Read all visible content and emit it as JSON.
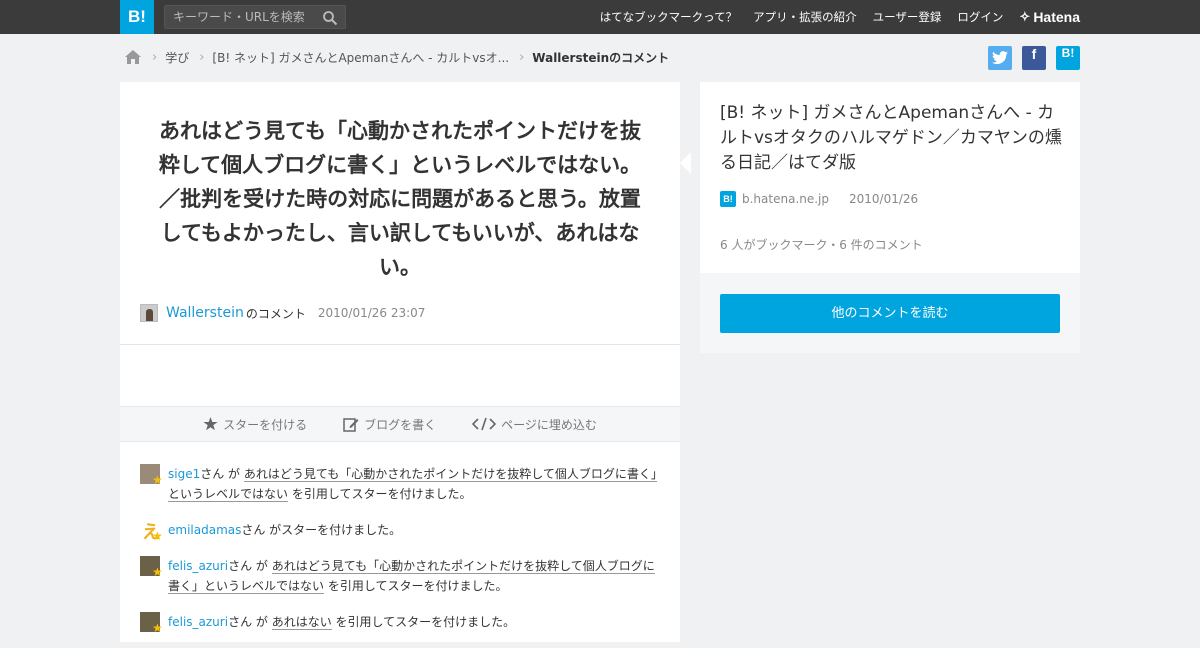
{
  "header": {
    "logo": "B!",
    "search_placeholder": "キーワード・URLを検索",
    "nav": [
      "はてなブックマークって？",
      "アプリ・拡張の紹介",
      "ユーザー登録",
      "ログイン"
    ],
    "brand": "Hatena"
  },
  "breadcrumb": {
    "items": [
      "学び",
      "[B! ネット] ガメさんとApemanさんへ - カルトvsオ...",
      "Wallersteinのコメント"
    ]
  },
  "share": {
    "twitter": "t",
    "facebook": "f",
    "hatena": "B!"
  },
  "comment": {
    "text": "あれはどう見ても「心動かされたポイントだけを抜粋して個人ブログに書く」というレベルではない。／批判を受けた時の対応に問題があると思う。放置してもよかったし、言い訳してもいいが、あれはない。",
    "author": "Wallerstein",
    "author_suffix": "のコメント",
    "date": "2010/01/26 23:07"
  },
  "actions": {
    "star": "スターを付ける",
    "blog": "ブログを書く",
    "embed": "ページに埋め込む"
  },
  "stars": [
    {
      "user": "sige1",
      "mid": "さん が ",
      "quote": "あれはどう見ても「心動かされたポイントだけを抜粋して個人ブログに書く」というレベルではない",
      "tail": " を引用してスターを付けました。"
    },
    {
      "user": "emiladamas",
      "mid": "さん がスターを付けました。",
      "quote": "",
      "tail": ""
    },
    {
      "user": "felis_azuri",
      "mid": "さん が ",
      "quote": "あれはどう見ても「心動かされたポイントだけを抜粋して個人ブログに書く」というレベルではない",
      "tail": " を引用してスターを付けました。"
    },
    {
      "user": "felis_azuri",
      "mid": "さん が ",
      "quote": "あれはない",
      "tail": " を引用してスターを付けました。"
    }
  ],
  "entry": {
    "title": "[B! ネット] ガメさんとApemanさんへ - カルトvsオタクのハルマゲドン／カマヤンの燻る日記／はてダ版",
    "favicon": "B!",
    "domain": "b.hatena.ne.jp",
    "date": "2010/01/26",
    "count": "6 人がブックマーク・6 件のコメント",
    "read_button": "他のコメントを読む"
  },
  "colors": {
    "accent": "#00a4de",
    "link": "#1a9ad6",
    "topbar": "#3b3b3b",
    "star": "#f7c000"
  }
}
